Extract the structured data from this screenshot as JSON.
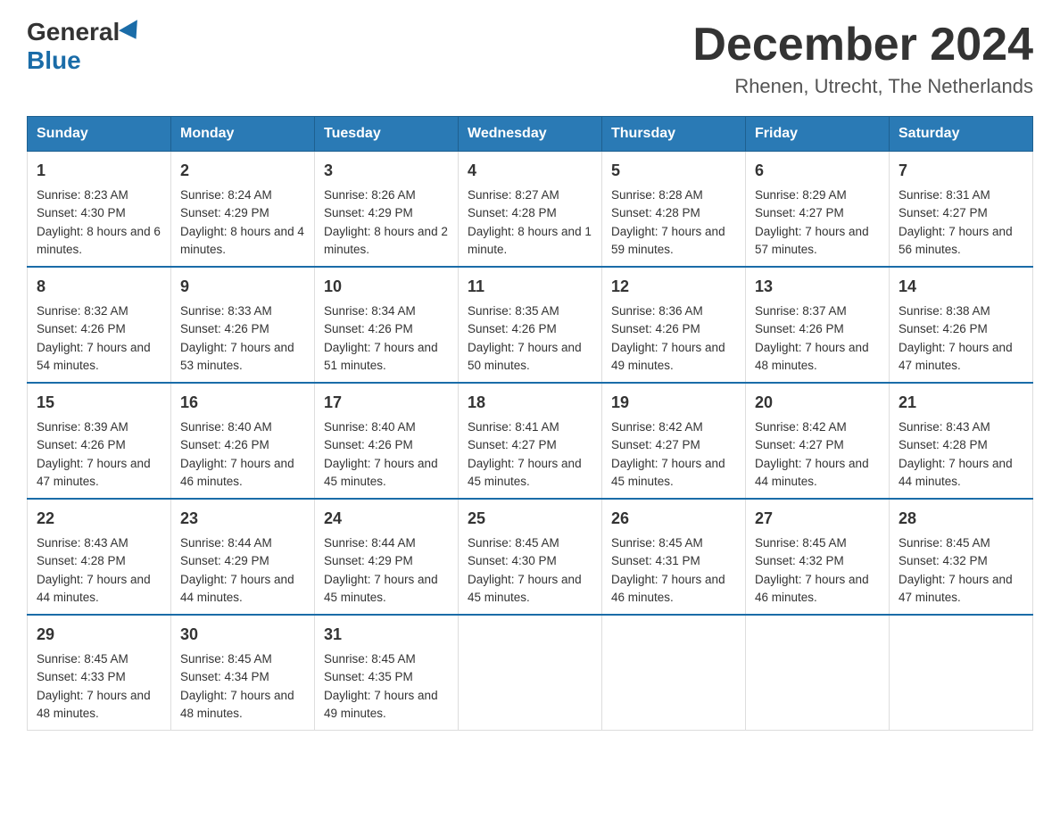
{
  "header": {
    "logo_general": "General",
    "logo_blue": "Blue",
    "title": "December 2024",
    "location": "Rhenen, Utrecht, The Netherlands"
  },
  "days_of_week": [
    "Sunday",
    "Monday",
    "Tuesday",
    "Wednesday",
    "Thursday",
    "Friday",
    "Saturday"
  ],
  "weeks": [
    [
      {
        "day": "1",
        "sunrise": "Sunrise: 8:23 AM",
        "sunset": "Sunset: 4:30 PM",
        "daylight": "Daylight: 8 hours and 6 minutes."
      },
      {
        "day": "2",
        "sunrise": "Sunrise: 8:24 AM",
        "sunset": "Sunset: 4:29 PM",
        "daylight": "Daylight: 8 hours and 4 minutes."
      },
      {
        "day": "3",
        "sunrise": "Sunrise: 8:26 AM",
        "sunset": "Sunset: 4:29 PM",
        "daylight": "Daylight: 8 hours and 2 minutes."
      },
      {
        "day": "4",
        "sunrise": "Sunrise: 8:27 AM",
        "sunset": "Sunset: 4:28 PM",
        "daylight": "Daylight: 8 hours and 1 minute."
      },
      {
        "day": "5",
        "sunrise": "Sunrise: 8:28 AM",
        "sunset": "Sunset: 4:28 PM",
        "daylight": "Daylight: 7 hours and 59 minutes."
      },
      {
        "day": "6",
        "sunrise": "Sunrise: 8:29 AM",
        "sunset": "Sunset: 4:27 PM",
        "daylight": "Daylight: 7 hours and 57 minutes."
      },
      {
        "day": "7",
        "sunrise": "Sunrise: 8:31 AM",
        "sunset": "Sunset: 4:27 PM",
        "daylight": "Daylight: 7 hours and 56 minutes."
      }
    ],
    [
      {
        "day": "8",
        "sunrise": "Sunrise: 8:32 AM",
        "sunset": "Sunset: 4:26 PM",
        "daylight": "Daylight: 7 hours and 54 minutes."
      },
      {
        "day": "9",
        "sunrise": "Sunrise: 8:33 AM",
        "sunset": "Sunset: 4:26 PM",
        "daylight": "Daylight: 7 hours and 53 minutes."
      },
      {
        "day": "10",
        "sunrise": "Sunrise: 8:34 AM",
        "sunset": "Sunset: 4:26 PM",
        "daylight": "Daylight: 7 hours and 51 minutes."
      },
      {
        "day": "11",
        "sunrise": "Sunrise: 8:35 AM",
        "sunset": "Sunset: 4:26 PM",
        "daylight": "Daylight: 7 hours and 50 minutes."
      },
      {
        "day": "12",
        "sunrise": "Sunrise: 8:36 AM",
        "sunset": "Sunset: 4:26 PM",
        "daylight": "Daylight: 7 hours and 49 minutes."
      },
      {
        "day": "13",
        "sunrise": "Sunrise: 8:37 AM",
        "sunset": "Sunset: 4:26 PM",
        "daylight": "Daylight: 7 hours and 48 minutes."
      },
      {
        "day": "14",
        "sunrise": "Sunrise: 8:38 AM",
        "sunset": "Sunset: 4:26 PM",
        "daylight": "Daylight: 7 hours and 47 minutes."
      }
    ],
    [
      {
        "day": "15",
        "sunrise": "Sunrise: 8:39 AM",
        "sunset": "Sunset: 4:26 PM",
        "daylight": "Daylight: 7 hours and 47 minutes."
      },
      {
        "day": "16",
        "sunrise": "Sunrise: 8:40 AM",
        "sunset": "Sunset: 4:26 PM",
        "daylight": "Daylight: 7 hours and 46 minutes."
      },
      {
        "day": "17",
        "sunrise": "Sunrise: 8:40 AM",
        "sunset": "Sunset: 4:26 PM",
        "daylight": "Daylight: 7 hours and 45 minutes."
      },
      {
        "day": "18",
        "sunrise": "Sunrise: 8:41 AM",
        "sunset": "Sunset: 4:27 PM",
        "daylight": "Daylight: 7 hours and 45 minutes."
      },
      {
        "day": "19",
        "sunrise": "Sunrise: 8:42 AM",
        "sunset": "Sunset: 4:27 PM",
        "daylight": "Daylight: 7 hours and 45 minutes."
      },
      {
        "day": "20",
        "sunrise": "Sunrise: 8:42 AM",
        "sunset": "Sunset: 4:27 PM",
        "daylight": "Daylight: 7 hours and 44 minutes."
      },
      {
        "day": "21",
        "sunrise": "Sunrise: 8:43 AM",
        "sunset": "Sunset: 4:28 PM",
        "daylight": "Daylight: 7 hours and 44 minutes."
      }
    ],
    [
      {
        "day": "22",
        "sunrise": "Sunrise: 8:43 AM",
        "sunset": "Sunset: 4:28 PM",
        "daylight": "Daylight: 7 hours and 44 minutes."
      },
      {
        "day": "23",
        "sunrise": "Sunrise: 8:44 AM",
        "sunset": "Sunset: 4:29 PM",
        "daylight": "Daylight: 7 hours and 44 minutes."
      },
      {
        "day": "24",
        "sunrise": "Sunrise: 8:44 AM",
        "sunset": "Sunset: 4:29 PM",
        "daylight": "Daylight: 7 hours and 45 minutes."
      },
      {
        "day": "25",
        "sunrise": "Sunrise: 8:45 AM",
        "sunset": "Sunset: 4:30 PM",
        "daylight": "Daylight: 7 hours and 45 minutes."
      },
      {
        "day": "26",
        "sunrise": "Sunrise: 8:45 AM",
        "sunset": "Sunset: 4:31 PM",
        "daylight": "Daylight: 7 hours and 46 minutes."
      },
      {
        "day": "27",
        "sunrise": "Sunrise: 8:45 AM",
        "sunset": "Sunset: 4:32 PM",
        "daylight": "Daylight: 7 hours and 46 minutes."
      },
      {
        "day": "28",
        "sunrise": "Sunrise: 8:45 AM",
        "sunset": "Sunset: 4:32 PM",
        "daylight": "Daylight: 7 hours and 47 minutes."
      }
    ],
    [
      {
        "day": "29",
        "sunrise": "Sunrise: 8:45 AM",
        "sunset": "Sunset: 4:33 PM",
        "daylight": "Daylight: 7 hours and 48 minutes."
      },
      {
        "day": "30",
        "sunrise": "Sunrise: 8:45 AM",
        "sunset": "Sunset: 4:34 PM",
        "daylight": "Daylight: 7 hours and 48 minutes."
      },
      {
        "day": "31",
        "sunrise": "Sunrise: 8:45 AM",
        "sunset": "Sunset: 4:35 PM",
        "daylight": "Daylight: 7 hours and 49 minutes."
      },
      null,
      null,
      null,
      null
    ]
  ]
}
